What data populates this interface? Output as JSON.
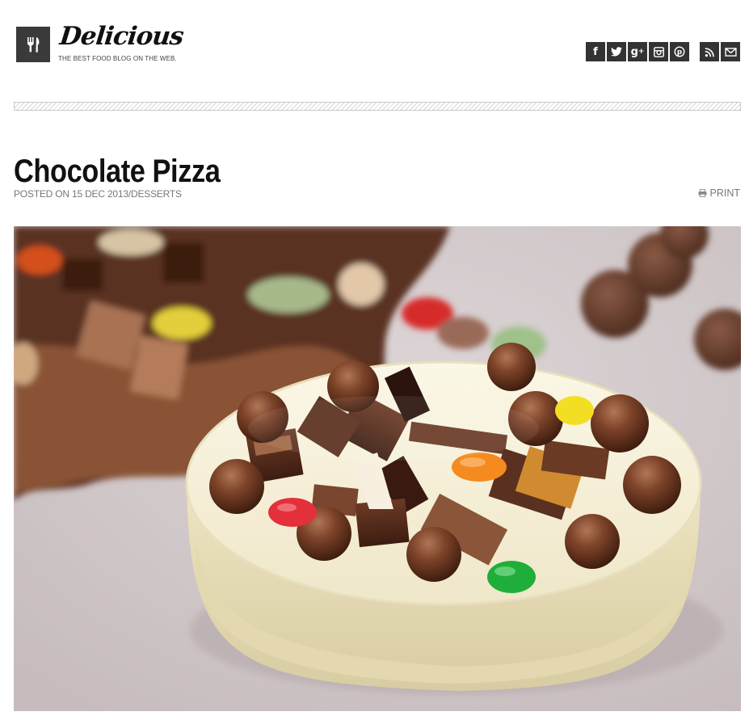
{
  "site": {
    "name": "Delicious",
    "tagline": "THE BEST FOOD BLOG ON THE WEB."
  },
  "social": {
    "group_main": [
      {
        "name": "facebook-icon",
        "glyph": "f"
      },
      {
        "name": "twitter-icon",
        "glyph": "t"
      },
      {
        "name": "google-plus-icon",
        "glyph": "g+"
      },
      {
        "name": "instagram-icon",
        "glyph": "◙"
      },
      {
        "name": "pinterest-icon",
        "glyph": "P"
      }
    ],
    "group_extra": [
      {
        "name": "rss-icon",
        "glyph": "◟"
      },
      {
        "name": "email-icon",
        "glyph": "✉"
      }
    ]
  },
  "post": {
    "title": "Chocolate Pizza",
    "meta": "POSTED ON 15 DEC 2013/DESSERTS",
    "print_label": "PRINT"
  },
  "colors": {
    "icon_bg": "#333333",
    "meta_text": "#777777"
  }
}
